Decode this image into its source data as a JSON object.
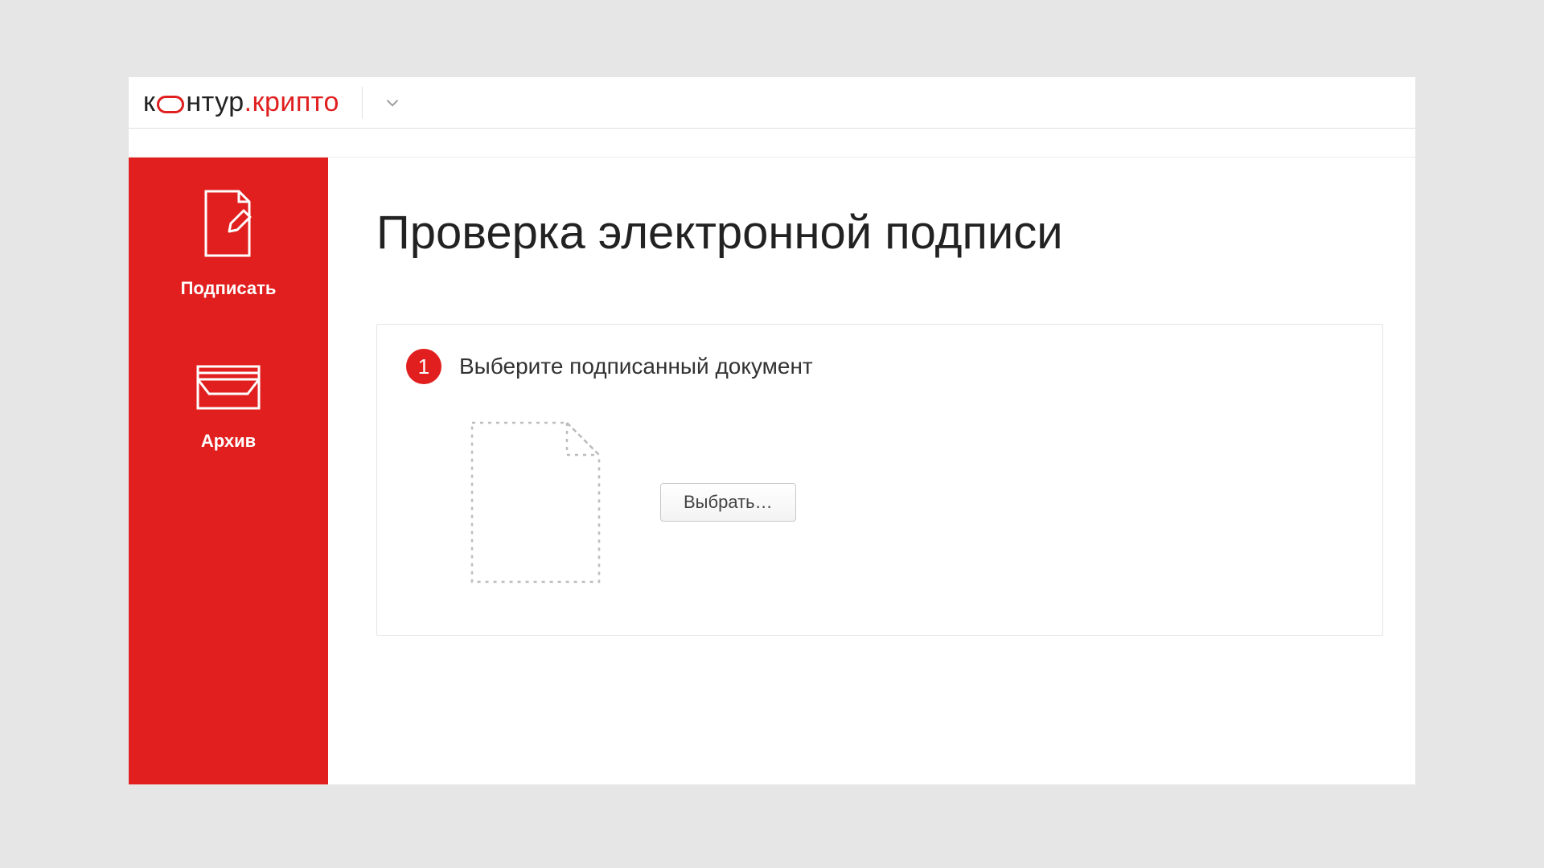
{
  "logo": {
    "part1": "к",
    "part2": "нтур",
    "dot": ".",
    "part3": "крипто"
  },
  "sidebar": {
    "items": [
      {
        "label": "Подписать"
      },
      {
        "label": "Архив"
      }
    ]
  },
  "main": {
    "title": "Проверка электронной подписи",
    "step": {
      "num": "1",
      "text": "Выберите подписанный документ",
      "button": "Выбрать…"
    }
  }
}
